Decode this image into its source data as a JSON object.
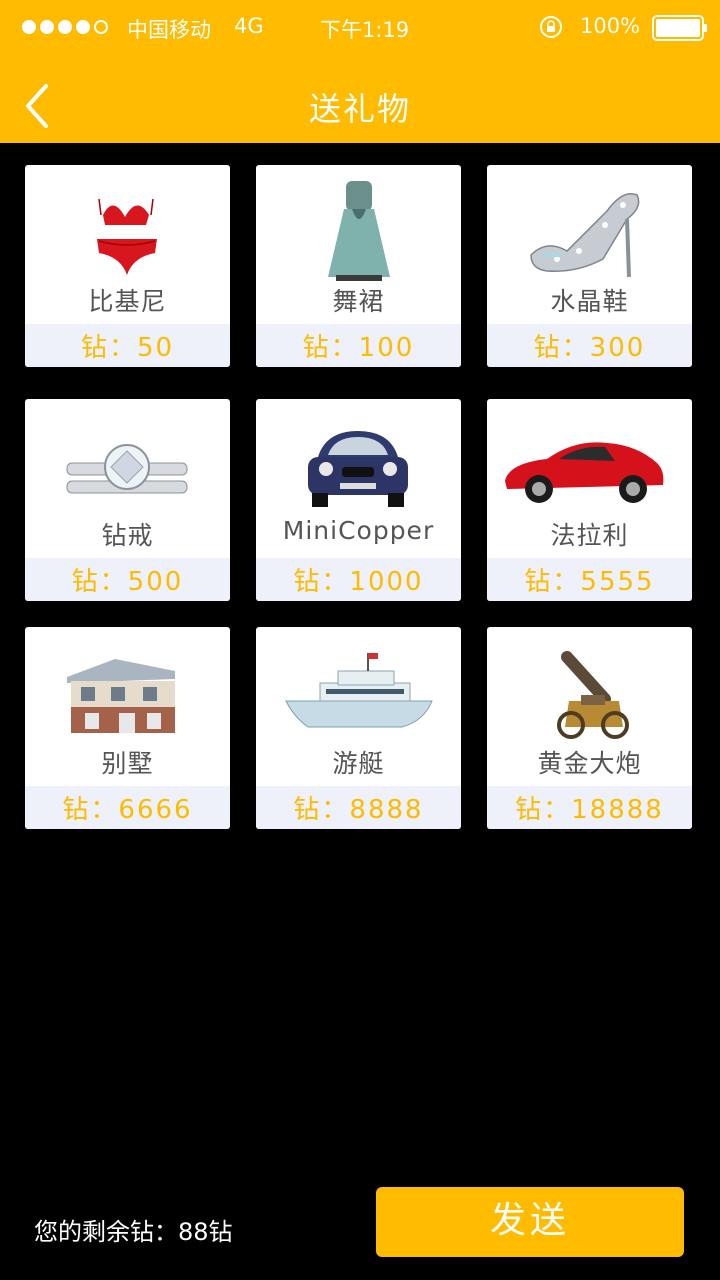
{
  "status_bar": {
    "carrier": "中国移动",
    "network": "4G",
    "time": "下午1:19",
    "battery": "100%"
  },
  "header": {
    "title": "送礼物",
    "back_icon": "chevron-left-icon"
  },
  "gifts": [
    {
      "name": "比基尼",
      "price": "钻：50"
    },
    {
      "name": "舞裙",
      "price": "钻：100"
    },
    {
      "name": "水晶鞋",
      "price": "钻：300"
    },
    {
      "name": "钻戒",
      "price": "钻：500"
    },
    {
      "name": "MiniCopper",
      "price": "钻：1000"
    },
    {
      "name": "法拉利",
      "price": "钻：5555"
    },
    {
      "name": "别墅",
      "price": "钻：6666"
    },
    {
      "name": "游艇",
      "price": "钻：8888"
    },
    {
      "name": "黄金大炮",
      "price": "钻：18888"
    }
  ],
  "footer": {
    "balance": "您的剩余钻：88钻",
    "send_label": "发送"
  },
  "colors": {
    "accent": "#FEBB00",
    "background": "#000000",
    "price_bar": "#EEF1FA"
  }
}
